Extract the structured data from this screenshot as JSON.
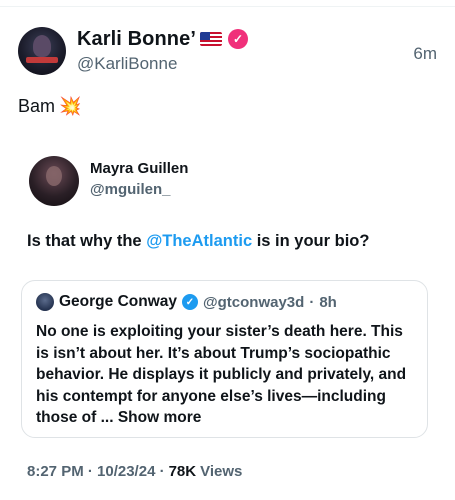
{
  "post": {
    "author_name": "Karli Bonne’",
    "author_handle": "@KarliBonne",
    "relative_time": "6m",
    "text": "Bam",
    "emoji": "💥",
    "flag_icon": "us-flag-icon",
    "badge_color": "#f0307a"
  },
  "quote": {
    "author_name": "Mayra Guillen",
    "author_handle": "@mguilen_",
    "text_before": "Is that why the ",
    "mention": "@TheAtlantic",
    "text_after": " is in your bio?",
    "link_color": "#1d9bf0"
  },
  "nested_quote": {
    "author_name": "George Conway",
    "author_handle": "@gtconway3d",
    "separator": "·",
    "relative_time": "8h",
    "body": "No one is exploiting your sister’s death here. This is isn’t about her.  It’s about Trump’s sociopathic behavior.  He displays it publicly and privately, and his contempt for anyone else’s lives—including those of ... ",
    "show_more": "Show more",
    "badge_color": "#1d9bf0"
  },
  "meta": {
    "timestamp": "8:27 PM · 10/23/24 ·",
    "views_count": "78K",
    "views_label": "Views"
  }
}
